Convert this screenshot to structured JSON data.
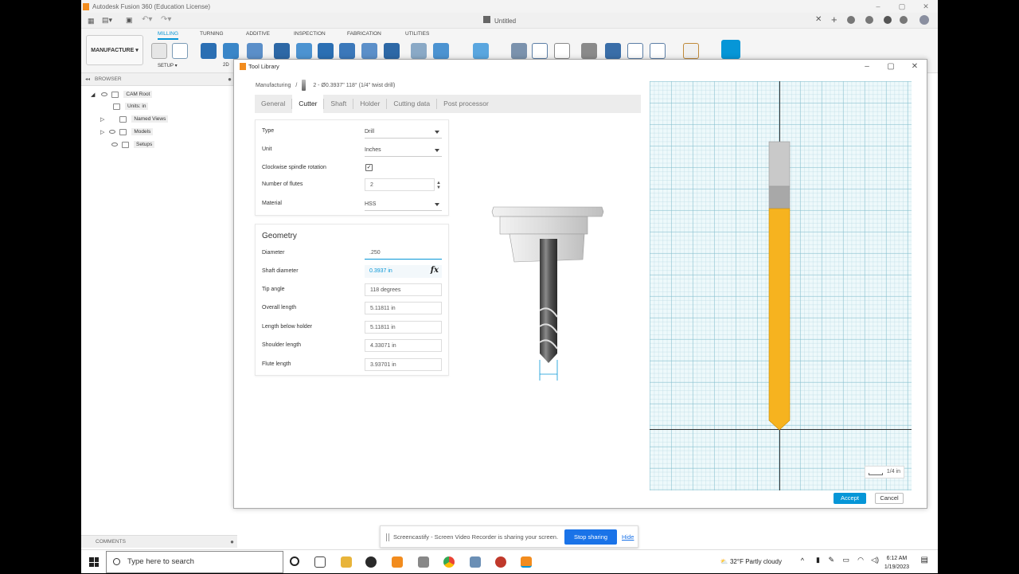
{
  "window": {
    "title": "Autodesk Fusion 360 (Education License)",
    "document_title": "Untitled"
  },
  "ribbon": {
    "workspace": "MANUFACTURE ▾",
    "tabs": [
      "MILLING",
      "TURNING",
      "ADDITIVE",
      "INSPECTION",
      "FABRICATION",
      "UTILITIES"
    ],
    "active_tab": "MILLING",
    "setup_label": "SETUP ▾",
    "partial_label": "2D"
  },
  "browser": {
    "header": "BROWSER",
    "items": [
      {
        "label": "CAM Root"
      },
      {
        "label": "Units: in"
      },
      {
        "label": "Named Views"
      },
      {
        "label": "Models"
      },
      {
        "label": "Setups"
      }
    ]
  },
  "comments_label": "COMMENTS",
  "dialog": {
    "title": "Tool Library",
    "breadcrumb_root": "Manufacturing",
    "breadcrumb_sep": "/",
    "breadcrumb_tool": "2 - Ø0.3937\" 118° (1/4\" twist drill)",
    "tabs": [
      "General",
      "Cutter",
      "Shaft",
      "Holder",
      "Cutting data",
      "Post processor"
    ],
    "active_tab": "Cutter",
    "props": {
      "type_label": "Type",
      "type_value": "Drill",
      "unit_label": "Unit",
      "unit_value": "Inches",
      "clockwise_label": "Clockwise spindle rotation",
      "clockwise_checked": "✓",
      "flutes_label": "Number of flutes",
      "flutes_value": "2",
      "material_label": "Material",
      "material_value": "HSS"
    },
    "geometry": {
      "title": "Geometry",
      "fields": [
        {
          "label": "Diameter",
          "value": ".250"
        },
        {
          "label": "Shaft diameter",
          "value": "0.3937 in"
        },
        {
          "label": "Tip angle",
          "value": "118 degrees"
        },
        {
          "label": "Overall length",
          "value": "5.11811 in"
        },
        {
          "label": "Length below holder",
          "value": "5.11811 in"
        },
        {
          "label": "Shoulder length",
          "value": "4.33071 in"
        },
        {
          "label": "Flute length",
          "value": "3.93701 in"
        }
      ],
      "fx_label": "fx"
    },
    "scale_label": "1/4 in",
    "accept_label": "Accept",
    "cancel_label": "Cancel",
    "colors": {
      "accent": "#0696d7",
      "tool_body": "#f6b31f",
      "shank": "#c9c9c9"
    }
  },
  "share_bar": {
    "message": "Screencastify - Screen Video Recorder is sharing your screen.",
    "stop_label": "Stop sharing",
    "hide_label": "Hide"
  },
  "taskbar": {
    "search_placeholder": "Type here to search",
    "weather": "32°F  Partly cloudy",
    "time": "6:12 AM",
    "date": "1/19/2023"
  }
}
